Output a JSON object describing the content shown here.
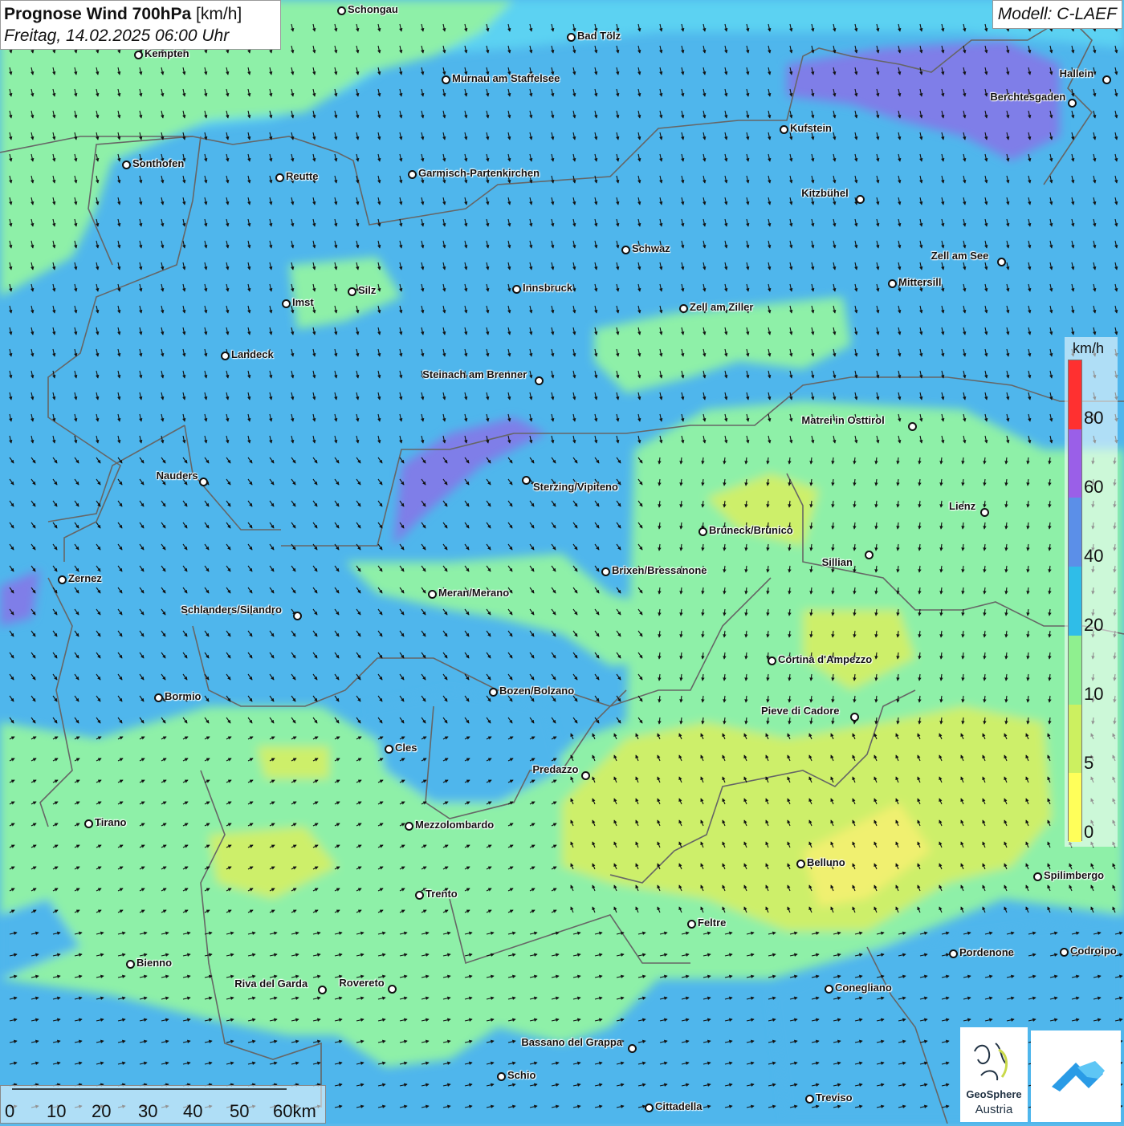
{
  "header": {
    "title_bold": "Prognose Wind 700hPa",
    "title_unit": "[km/h]",
    "datetime": "Freitag, 14.02.2025 06:00 Uhr"
  },
  "model": "Modell: C-LAEF",
  "legend": {
    "unit": "km/h",
    "ticks": [
      "80",
      "60",
      "40",
      "20",
      "10",
      "5",
      "0"
    ],
    "colors": [
      "#ff3030",
      "#9a5fe8",
      "#5b8fe8",
      "#2fbde8",
      "#8ff08f",
      "#ccf060",
      "#ffff5a"
    ]
  },
  "scale": {
    "labels": [
      "0",
      "10",
      "20",
      "30",
      "40",
      "50",
      "60km"
    ]
  },
  "logo": {
    "name_line1": "GeoSphere",
    "name_line2": "Austria"
  },
  "cities": [
    {
      "name": "Schongau"
    },
    {
      "name": "Bad Tölz"
    },
    {
      "name": "Kempten"
    },
    {
      "name": "Murnau am Staffelsee"
    },
    {
      "name": "Hallein"
    },
    {
      "name": "Berchtesgaden"
    },
    {
      "name": "Kufstein"
    },
    {
      "name": "Sonthofen"
    },
    {
      "name": "Reutte"
    },
    {
      "name": "Garmisch-Partenkirchen"
    },
    {
      "name": "Kitzbühel"
    },
    {
      "name": "Schwaz"
    },
    {
      "name": "Zell am See"
    },
    {
      "name": "Mittersill"
    },
    {
      "name": "Innsbruck"
    },
    {
      "name": "Silz"
    },
    {
      "name": "Imst"
    },
    {
      "name": "Zell am Ziller"
    },
    {
      "name": "Landeck"
    },
    {
      "name": "Steinach am Brenner"
    },
    {
      "name": "Matrei in Osttirol"
    },
    {
      "name": "Nauders"
    },
    {
      "name": "Sterzing/Vipiteno"
    },
    {
      "name": "Lienz"
    },
    {
      "name": "Bruneck/Brunico"
    },
    {
      "name": "Sillian"
    },
    {
      "name": "Zernez"
    },
    {
      "name": "Brixen/Bressanone"
    },
    {
      "name": "Meran/Merano"
    },
    {
      "name": "Schlanders/Silandro"
    },
    {
      "name": "Cortina d'Ampezzo"
    },
    {
      "name": "Bozen/Bolzano"
    },
    {
      "name": "Bormio"
    },
    {
      "name": "Pieve di Cadore"
    },
    {
      "name": "Cles"
    },
    {
      "name": "Predazzo"
    },
    {
      "name": "Tirano"
    },
    {
      "name": "Mezzolombardo"
    },
    {
      "name": "Belluno"
    },
    {
      "name": "Spilimbergo"
    },
    {
      "name": "Trento"
    },
    {
      "name": "Feltre"
    },
    {
      "name": "Pordenone"
    },
    {
      "name": "Codroipo"
    },
    {
      "name": "Bienno"
    },
    {
      "name": "Riva del Garda"
    },
    {
      "name": "Rovereto"
    },
    {
      "name": "Conegliano"
    },
    {
      "name": "Bassano del Grappa"
    },
    {
      "name": "Schio"
    },
    {
      "name": "Treviso"
    },
    {
      "name": "Cittadella"
    }
  ]
}
